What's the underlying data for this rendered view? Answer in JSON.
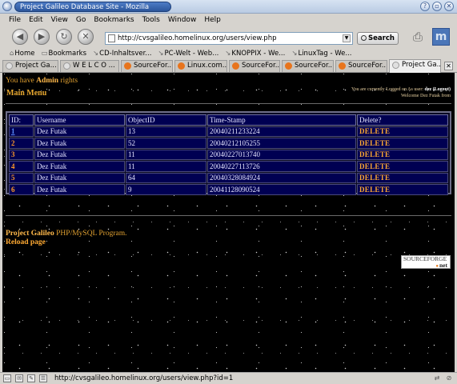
{
  "window": {
    "title": "Project Galileo Database Site - Mozilla",
    "buttons": [
      "?",
      "▫",
      "✕"
    ]
  },
  "menu": [
    "File",
    "Edit",
    "View",
    "Go",
    "Bookmarks",
    "Tools",
    "Window",
    "Help"
  ],
  "nav": {
    "url": "http://cvsgalileo.homelinux.org/users/view.php",
    "search_label": "Search"
  },
  "bookmarks": [
    "Home",
    "Bookmarks",
    "CD-Inhaltsver...",
    "PC-Welt - Web...",
    "KNOPPIX - We...",
    "LinuxTag - We..."
  ],
  "tabs": [
    {
      "label": "Project Ga...",
      "active": false,
      "icon_color": "#e0e0e0"
    },
    {
      "label": "W E L C O ...",
      "active": false,
      "icon_color": "#e0e0e0"
    },
    {
      "label": "SourceFor...",
      "active": false,
      "icon_color": "#e8741c"
    },
    {
      "label": "Linux.com...",
      "active": false,
      "icon_color": "#e8741c"
    },
    {
      "label": "SourceFor...",
      "active": false,
      "icon_color": "#e8741c"
    },
    {
      "label": "SourceFor...",
      "active": false,
      "icon_color": "#e8741c"
    },
    {
      "label": "SourceFor...",
      "active": false,
      "icon_color": "#e8741c"
    },
    {
      "label": "Project Ga...",
      "active": true,
      "icon_color": "#e0e0e0"
    }
  ],
  "page": {
    "rights_prefix": "You have",
    "rights_role": "Admin",
    "rights_suffix": "rights",
    "main_menu": "Main Menu",
    "login_prefix": "You are currently Logged on As user:",
    "login_user": "dez",
    "login_logout": "(Logout)",
    "welcome": "Welcome Dez Futak from",
    "table": {
      "headers": [
        "ID:",
        "Username",
        "ObjectID",
        "Time-Stamp",
        "Delete?"
      ],
      "rows": [
        {
          "id": "1",
          "username": "Dez Futak",
          "object_id": "13",
          "timestamp": "20040211233224",
          "action": "DELETE"
        },
        {
          "id": "2",
          "username": "Dez Futak",
          "object_id": "52",
          "timestamp": "20040212105255",
          "action": "DELETE"
        },
        {
          "id": "3",
          "username": "Dez Futak",
          "object_id": "11",
          "timestamp": "20040227013740",
          "action": "DELETE"
        },
        {
          "id": "4",
          "username": "Dez Futak",
          "object_id": "11",
          "timestamp": "20040227113726",
          "action": "DELETE"
        },
        {
          "id": "5",
          "username": "Dez Futak",
          "object_id": "64",
          "timestamp": "20040328084924",
          "action": "DELETE"
        },
        {
          "id": "6",
          "username": "Dez Futak",
          "object_id": "9",
          "timestamp": "20041128090524",
          "action": "DELETE"
        }
      ]
    },
    "footer_project": "Project",
    "footer_name": "Galileo",
    "footer_rest": "PHP/MySQL Program.",
    "reload": "Reload page",
    "sf_logo_top": "SOURCEFORGE",
    "sf_logo_bottom": "net"
  },
  "status": {
    "text": "http://cvsgalileo.homelinux.org/users/view.php?id=1"
  },
  "colors": {
    "content_bg": "#000000",
    "table_bg": "#000052",
    "accent": "#e0a030"
  }
}
